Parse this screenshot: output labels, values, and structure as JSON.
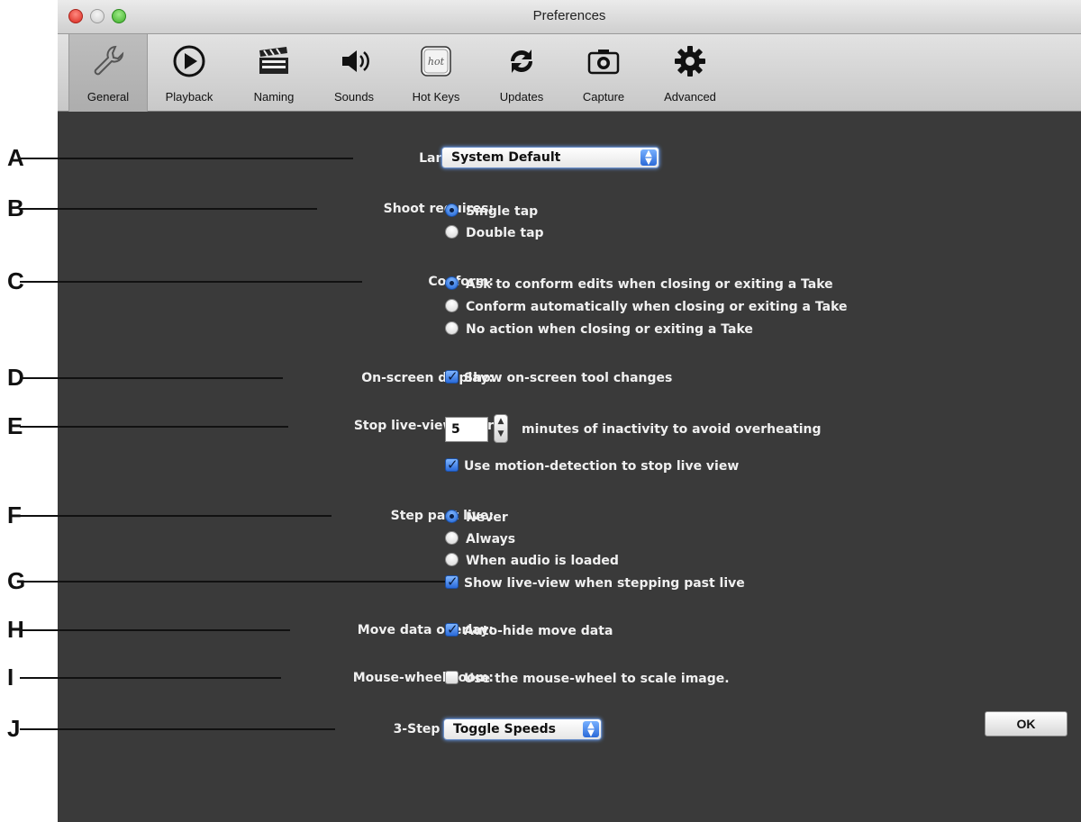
{
  "window": {
    "title": "Preferences"
  },
  "toolbar": {
    "tabs": [
      {
        "label": "General",
        "icon": "wrench-icon",
        "selected": true
      },
      {
        "label": "Playback",
        "icon": "play-icon"
      },
      {
        "label": "Naming",
        "icon": "clapperboard-icon"
      },
      {
        "label": "Sounds",
        "icon": "speaker-icon"
      },
      {
        "label": "Hot Keys",
        "icon": "hotkey-icon",
        "icon_text": "hot"
      },
      {
        "label": "Updates",
        "icon": "refresh-icon"
      },
      {
        "label": "Capture",
        "icon": "camera-icon"
      },
      {
        "label": "Advanced",
        "icon": "gear-icon"
      }
    ]
  },
  "callouts": [
    "A",
    "B",
    "C",
    "D",
    "E",
    "F",
    "G",
    "H",
    "I",
    "J"
  ],
  "settings": {
    "language": {
      "label": "Language:",
      "value": "System Default"
    },
    "shoot": {
      "label": "Shoot requires:",
      "options": [
        "Single tap",
        "Double tap"
      ],
      "selected": 0
    },
    "conform": {
      "label": "Conform:",
      "options": [
        "Ask to conform edits when closing or exiting a Take",
        "Conform automatically when closing or exiting a Take",
        "No action when closing or exiting a Take"
      ],
      "selected": 0
    },
    "onscreen": {
      "label": "On-screen display:",
      "checkbox": "Show on-screen tool changes",
      "checked": true
    },
    "liveview": {
      "label": "Stop live-view after",
      "minutes": "5",
      "suffix": "minutes of inactivity to avoid overheating",
      "motion_checkbox": "Use motion-detection to stop live view",
      "motion_checked": true
    },
    "steppast": {
      "label": "Step past live:",
      "options": [
        "Never",
        "Always",
        "When audio is loaded"
      ],
      "selected": 0,
      "show_checkbox": "Show live-view when stepping past live",
      "show_checked": true
    },
    "moveoverlay": {
      "label": "Move data overlay:",
      "checkbox": "Auto-hide move data",
      "checked": true
    },
    "mousewheel": {
      "label": "Mouse-wheel zoom:",
      "checkbox": "Use the mouse-wheel to scale image.",
      "checked": false
    },
    "speed": {
      "label": "3-Step Speed:",
      "value": "Toggle Speeds"
    }
  },
  "ok_label": "OK",
  "colors": {
    "content_bg": "#3a3a3a",
    "accent": "#2a6ad8"
  }
}
